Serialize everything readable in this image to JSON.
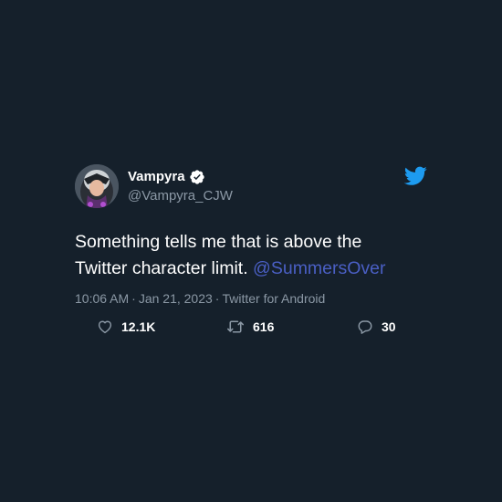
{
  "user": {
    "display_name": "Vampyra",
    "handle": "@Vampyra_CJW",
    "verified": true
  },
  "tweet": {
    "line1": "Something tells me that is above the",
    "line2_text": "Twitter character limit.",
    "mention": "@SummersOver",
    "time": "10:06 AM",
    "separator": "·",
    "date": "Jan 21, 2023",
    "source": "Twitter for Android"
  },
  "actions": {
    "likes": "12.1K",
    "retweets": "616",
    "replies": "30"
  },
  "icons": {
    "brand": "twitter-bird-icon",
    "verified": "verified-badge-icon",
    "like": "heart-icon",
    "retweet": "retweet-icon",
    "reply": "reply-icon"
  },
  "colors": {
    "background": "#15202b",
    "brand_blue": "#1d9bf0",
    "mention": "#4a5fc4",
    "secondary_text": "#8b98a5"
  }
}
